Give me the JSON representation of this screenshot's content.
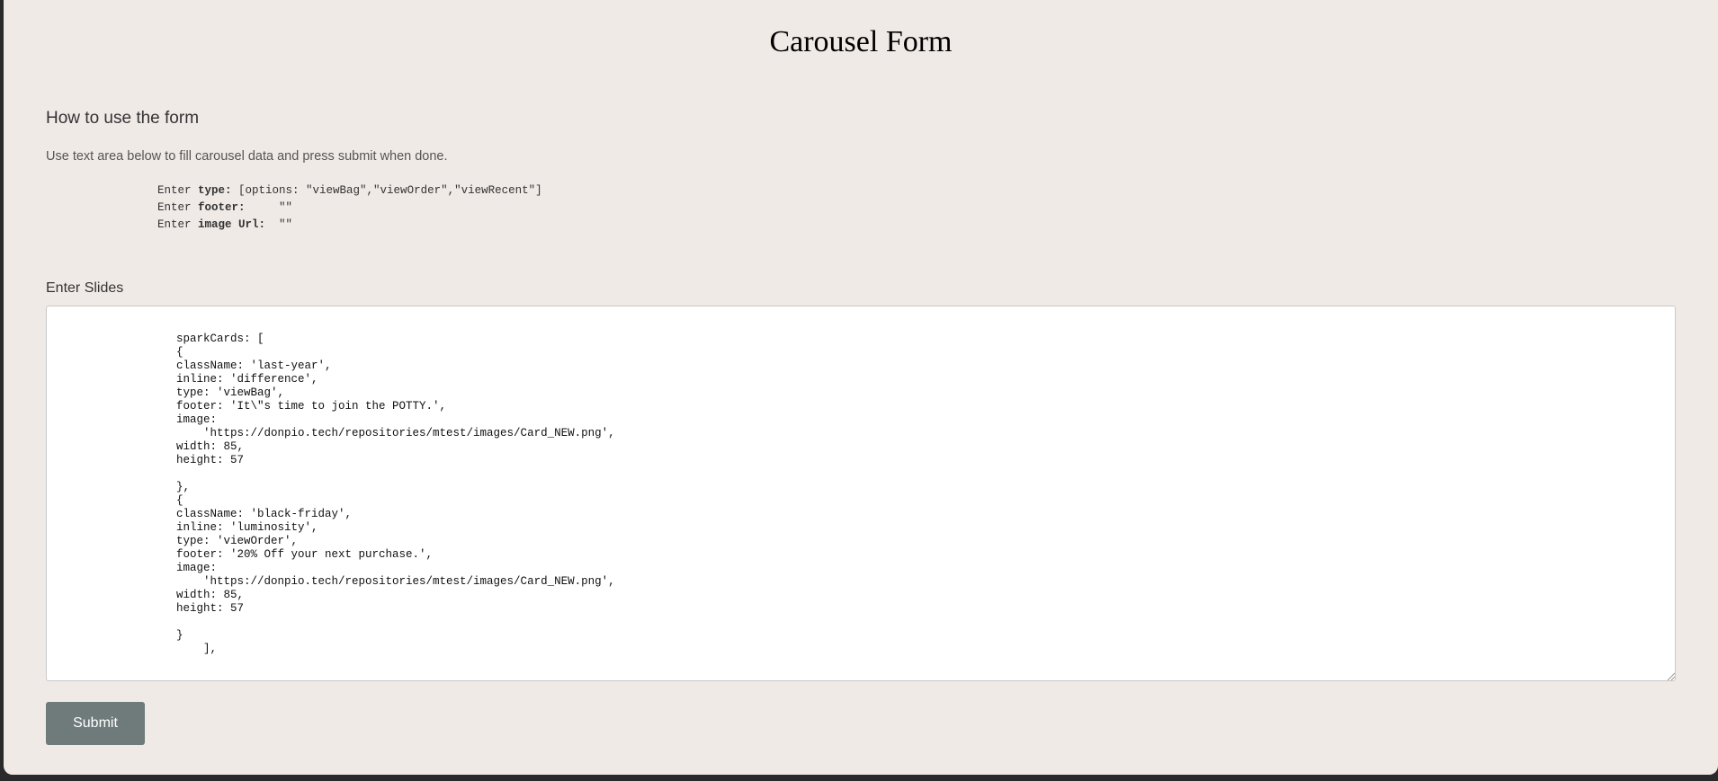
{
  "page": {
    "title": "Carousel Form",
    "howto_heading": "How to use the form",
    "instructions": "Use text area below to fill carousel data and press submit when done."
  },
  "spec_lines": [
    {
      "prefix": "Enter ",
      "field": "type:",
      "value": " [options: \"viewBag\",\"viewOrder\",\"viewRecent\"]"
    },
    {
      "prefix": "Enter ",
      "field": "footer:",
      "value": "     \"\""
    },
    {
      "prefix": "Enter ",
      "field": "image Url:",
      "value": "  \"\""
    }
  ],
  "slides": {
    "label": "Enter Slides",
    "value": "sparkCards: [\n{\nclassName: 'last-year',\ninline: 'difference',\ntype: 'viewBag',\nfooter: 'It\\\"s time to join the POTTY.',\nimage:\n    'https://donpio.tech/repositories/mtest/images/Card_NEW.png',\nwidth: 85,\nheight: 57\n\n},\n{\nclassName: 'black-friday',\ninline: 'luminosity',\ntype: 'viewOrder',\nfooter: '20% Off your next purchase.',\nimage:\n    'https://donpio.tech/repositories/mtest/images/Card_NEW.png',\nwidth: 85,\nheight: 57\n\n}\n    ],"
  },
  "submit_label": "Submit",
  "colors": {
    "page_bg": "#f0eae7",
    "button_bg": "#6f7a7a",
    "button_text": "#ffffff"
  }
}
